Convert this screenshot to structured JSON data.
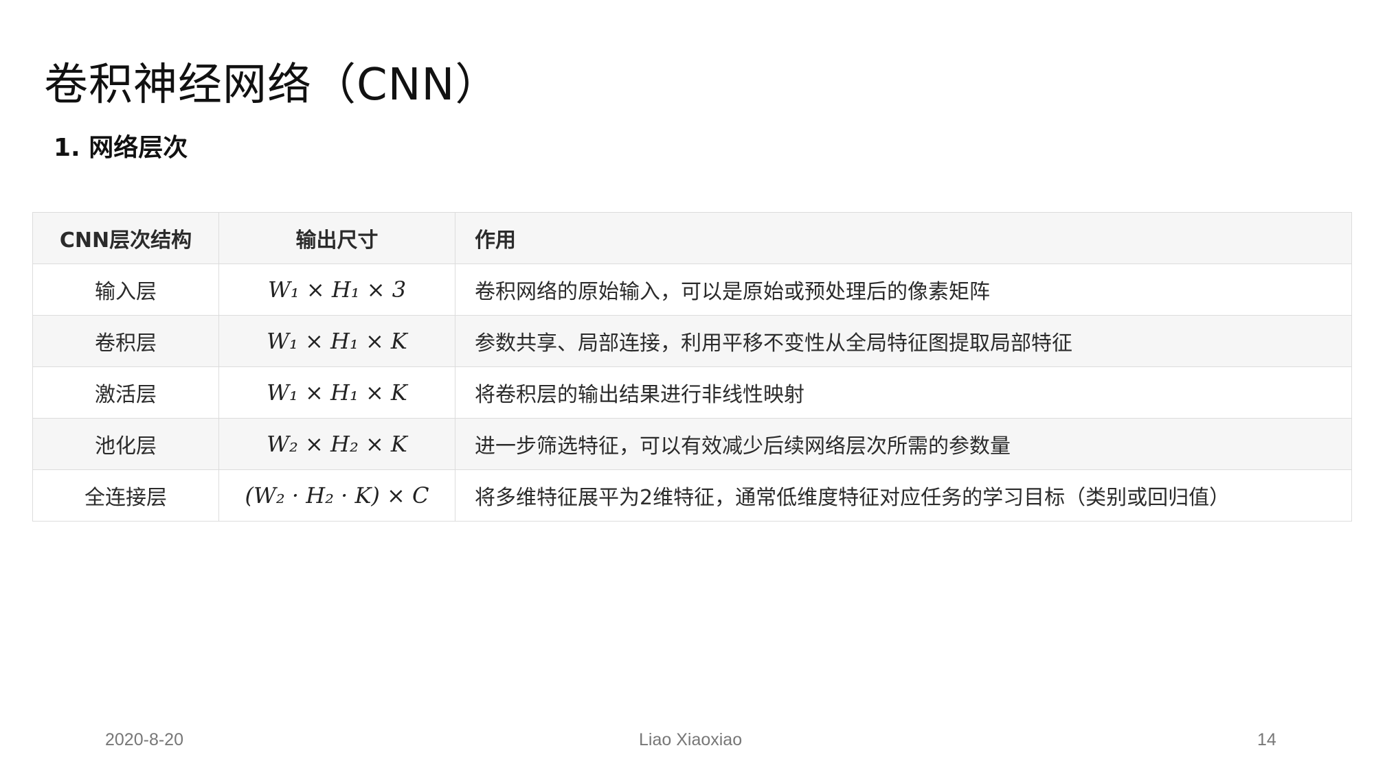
{
  "slide": {
    "title": "卷积神经网络（CNN）",
    "section_heading": "1. 网络层次"
  },
  "table": {
    "headers": [
      "CNN层次结构",
      "输出尺寸",
      "作用"
    ],
    "rows": [
      {
        "layer": "输入层",
        "output_size": "W₁ × H₁ × 3",
        "description": "卷积网络的原始输入，可以是原始或预处理后的像素矩阵"
      },
      {
        "layer": "卷积层",
        "output_size": "W₁ × H₁ × K",
        "description": "参数共享、局部连接，利用平移不变性从全局特征图提取局部特征"
      },
      {
        "layer": "激活层",
        "output_size": "W₁ × H₁ × K",
        "description": "将卷积层的输出结果进行非线性映射"
      },
      {
        "layer": "池化层",
        "output_size": "W₂ × H₂ × K",
        "description": "进一步筛选特征，可以有效减少后续网络层次所需的参数量"
      },
      {
        "layer": "全连接层",
        "output_size": "(W₂ · H₂ · K) × C",
        "description": "将多维特征展平为2维特征，通常低维度特征对应任务的学习目标（类别或回归值）"
      }
    ]
  },
  "footer": {
    "date": "2020-8-20",
    "author": "Liao Xiaoxiao",
    "page_number": "14"
  }
}
